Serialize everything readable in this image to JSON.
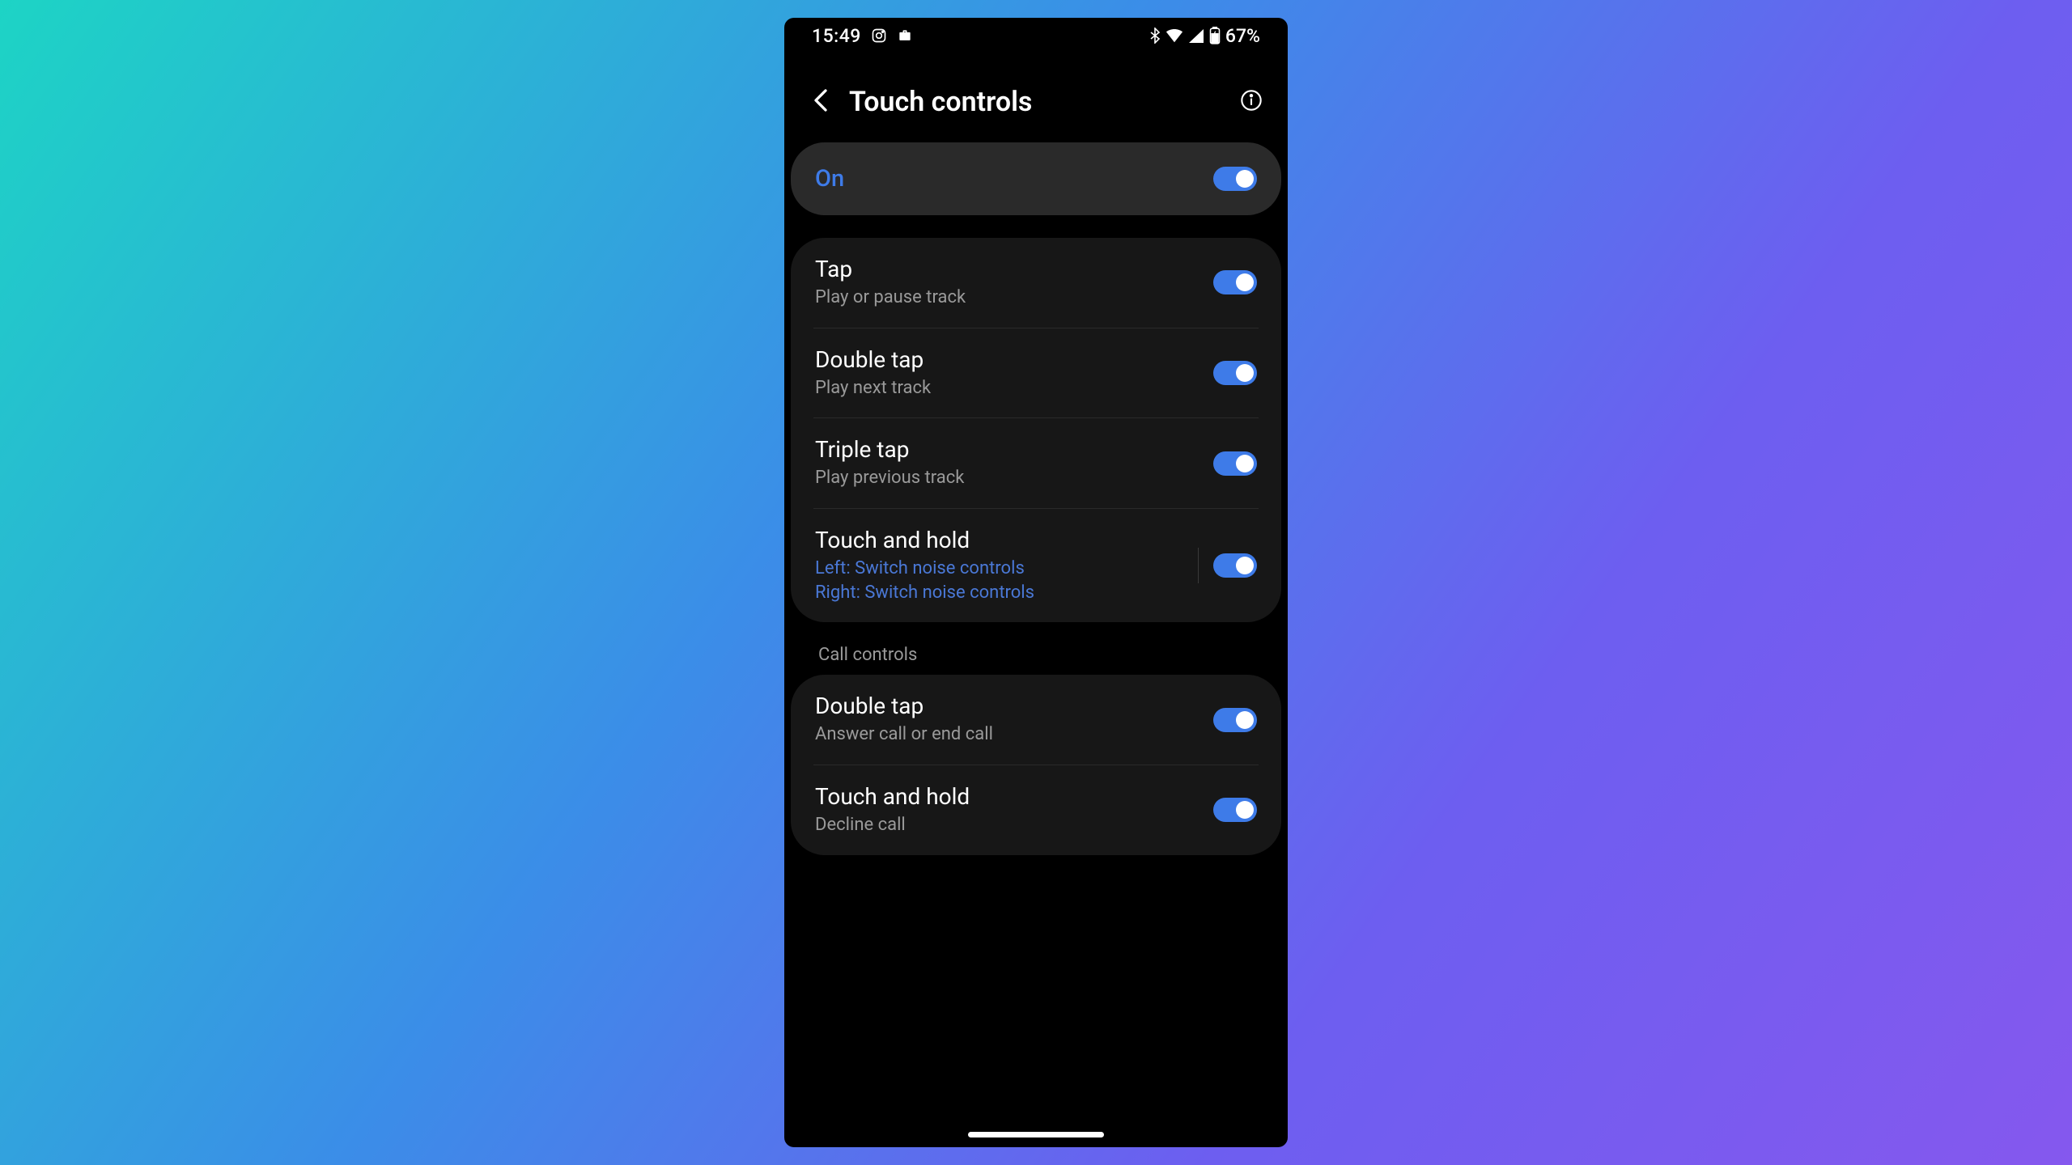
{
  "status": {
    "time": "15:49",
    "battery_pct": "67%"
  },
  "header": {
    "title": "Touch controls"
  },
  "master": {
    "label": "On",
    "enabled": true
  },
  "gestures": [
    {
      "title": "Tap",
      "sub": "Play or pause track",
      "enabled": true
    },
    {
      "title": "Double tap",
      "sub": "Play next track",
      "enabled": true
    },
    {
      "title": "Triple tap",
      "sub": "Play previous track",
      "enabled": true
    },
    {
      "title": "Touch and hold",
      "sub_left": "Left: Switch noise controls",
      "sub_right": "Right: Switch noise controls",
      "enabled": true,
      "has_sep": true
    }
  ],
  "section2_header": "Call controls",
  "call_controls": [
    {
      "title": "Double tap",
      "sub": "Answer call or end call",
      "enabled": true
    },
    {
      "title": "Touch and hold",
      "sub": "Decline call",
      "enabled": true
    }
  ]
}
